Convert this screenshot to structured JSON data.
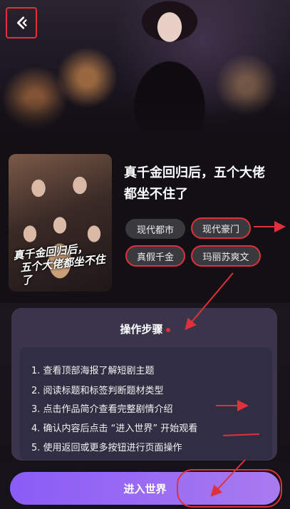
{
  "drama": {
    "title_line1": "真千金回归后，五个大佬",
    "title_line2": "都坐不住了",
    "poster_title_line1": "真千金回归后，",
    "poster_title_line2": "五个大佬都坐不住了",
    "tags": [
      "现代都市",
      "现代豪门",
      "真假千金",
      "玛丽苏爽文"
    ]
  },
  "steps_card": {
    "heading": "操作步骤",
    "steps": [
      "1. 查看顶部海报了解短剧主题",
      "2. 阅读标题和标签判断题材类型",
      "3. 点击作品简介查看完整剧情介绍",
      "4. 确认内容后点击 “进入世界” 开始观看",
      "5. 使用返回或更多按钮进行页面操作"
    ]
  },
  "cta": {
    "label": "进入世界"
  },
  "colors": {
    "accent": "#8b5cf6",
    "annotation": "#e0313a",
    "background": "#120f15"
  },
  "icons": {
    "back": "chevron-left-icon"
  }
}
